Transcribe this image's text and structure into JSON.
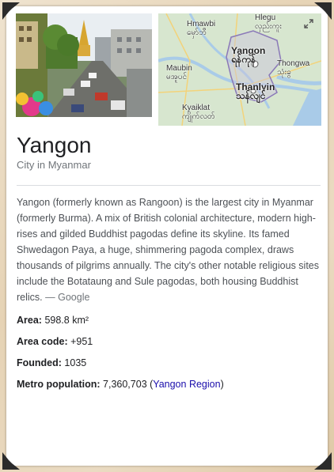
{
  "photo": {
    "alt": "Yangon city street with Sule Pagoda"
  },
  "map": {
    "labels": {
      "hmawbi_en": "Hmawbi",
      "hmawbi_my": "မှော်ဘီ",
      "hlegu_en": "Hlegu",
      "hlegu_my": "လှည်းကူး",
      "yangon_en": "Yangon",
      "yangon_my": "ရန်ကုန်",
      "maubin_en": "Maubin",
      "maubin_my": "မအူပင်",
      "thongwa_en": "Thongwa",
      "thongwa_my": "သုံးခွ",
      "thanlyin_en": "Thanlyin",
      "thanlyin_my": "သန်လျင်",
      "kyaiklat_en": "Kyaiklat",
      "kyaiklat_my": "ကျိုက်လတ်"
    },
    "expand_icon": "expand-icon"
  },
  "entity": {
    "title": "Yangon",
    "subtitle": "City in Myanmar"
  },
  "description": {
    "text": "Yangon (formerly known as Rangoon) is the largest city in Myanmar (formerly Burma). A mix of British colonial architecture, modern high-rises and gilded Buddhist pagodas define its skyline. Its famed Shwedagon Paya, a huge, shimmering pagoda complex, draws thousands of pilgrims annually. The city's other notable religious sites include the Botataung and Sule pagodas, both housing Buddhist relics.",
    "source": "— Google"
  },
  "facts": {
    "area_label": "Area:",
    "area_value": "598.8 km²",
    "area_code_label": "Area code:",
    "area_code_value": "+951",
    "founded_label": "Founded:",
    "founded_value": "1035",
    "metro_label": "Metro population:",
    "metro_value": "7,360,703",
    "metro_link": "Yangon Region"
  },
  "colors": {
    "link": "#1a0dab",
    "title": "#202124",
    "muted": "#70757a"
  }
}
